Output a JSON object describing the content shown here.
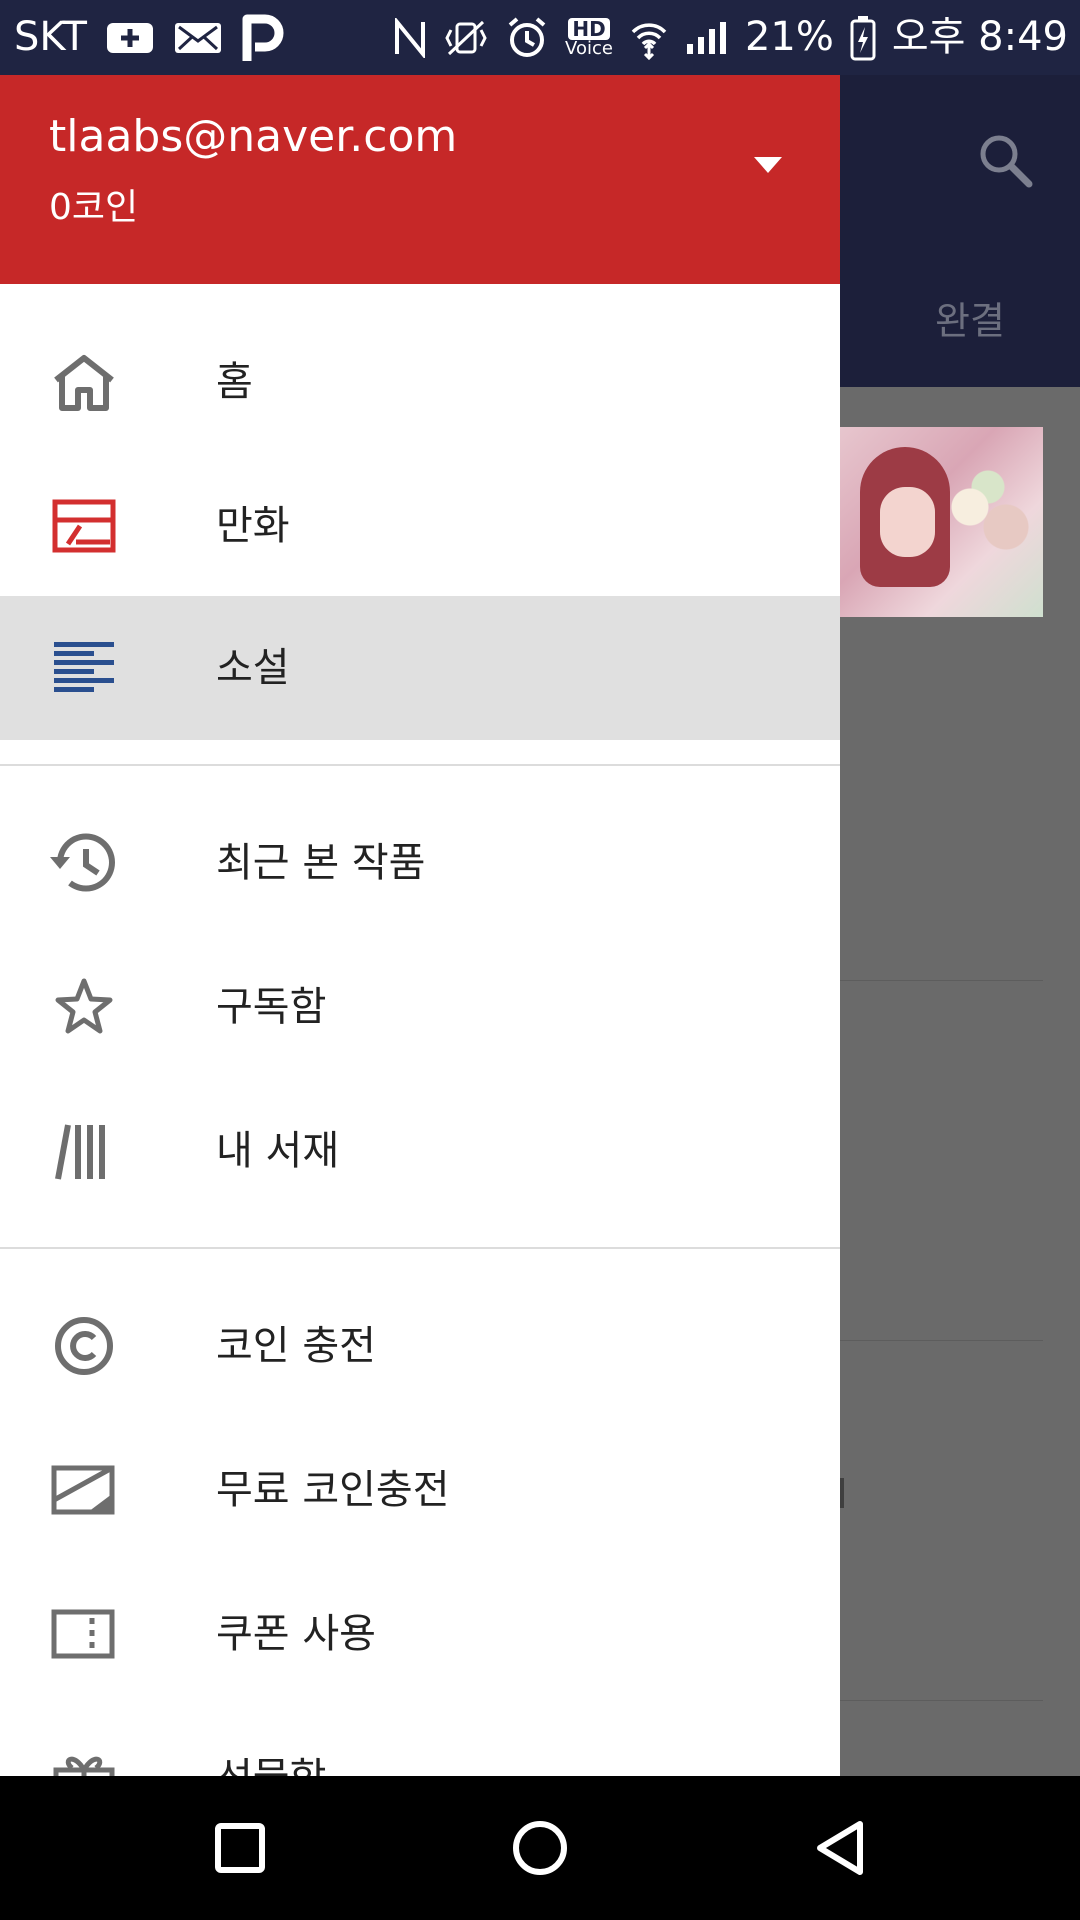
{
  "status_bar": {
    "carrier": "SKT",
    "battery": "21%",
    "time": "오후 8:49",
    "hd_voice_top": "HD",
    "hd_voice_bottom": "Voice",
    "icons": [
      "add-icon",
      "mail-icon",
      "p-app-icon",
      "nfc-icon",
      "vibrate-icon",
      "alarm-icon",
      "hd-voice-icon",
      "wifi-icon",
      "signal-icon",
      "battery-charging-icon"
    ]
  },
  "background_app": {
    "tab_label": "완결",
    "search_icon": "search-icon"
  },
  "drawer": {
    "account": {
      "email": "tlaabs@naver.com",
      "coins": "0코인"
    },
    "sections": [
      {
        "items": [
          {
            "label": "홈",
            "icon": "home-icon",
            "selected": false
          },
          {
            "label": "만화",
            "icon": "comic-icon",
            "selected": false
          },
          {
            "label": "소설",
            "icon": "novel-icon",
            "selected": true
          }
        ]
      },
      {
        "items": [
          {
            "label": "최근 본 작품",
            "icon": "history-icon",
            "selected": false
          },
          {
            "label": "구독함",
            "icon": "star-icon",
            "selected": false
          },
          {
            "label": "내 서재",
            "icon": "library-icon",
            "selected": false
          }
        ]
      },
      {
        "items": [
          {
            "label": "코인 충전",
            "icon": "coin-icon",
            "selected": false
          },
          {
            "label": "무료 코인충전",
            "icon": "free-coin-icon",
            "selected": false
          },
          {
            "label": "쿠폰 사용",
            "icon": "coupon-icon",
            "selected": false
          },
          {
            "label": "선물함",
            "icon": "gift-icon",
            "selected": false
          }
        ]
      }
    ]
  },
  "colors": {
    "header_red": "#c62828",
    "status_bar_navy": "#1f2442",
    "app_bar_navy": "#1c1f3a",
    "selected_bg": "#e0e0e0",
    "icon_gray": "#6e6e6e",
    "comic_red": "#d32f2f",
    "novel_blue": "#2a4f8f"
  },
  "nav_bar": {
    "buttons": [
      "recent-apps-button",
      "home-button",
      "back-button"
    ]
  }
}
